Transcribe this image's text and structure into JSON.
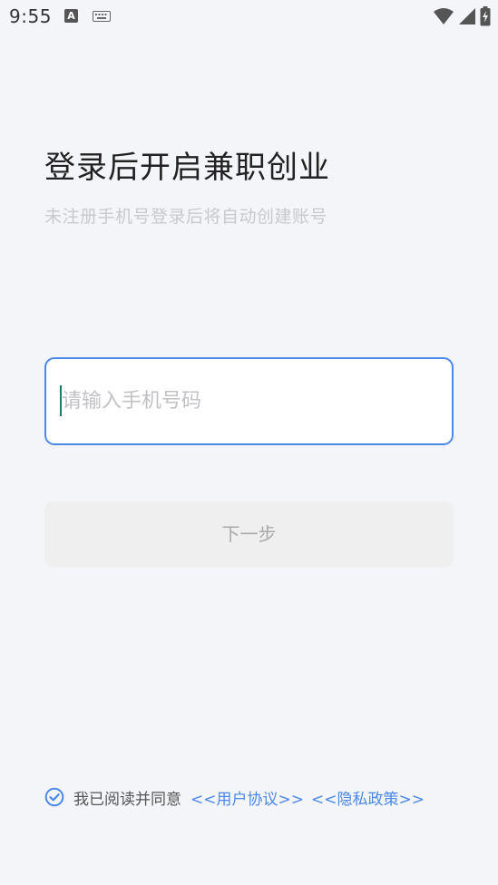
{
  "status_bar": {
    "time": "9:55",
    "notification_letter": "A"
  },
  "header": {
    "title": "登录后开启兼职创业",
    "subtitle": "未注册手机号登录后将自动创建账号"
  },
  "phone": {
    "value": "",
    "placeholder": "请输入手机号码"
  },
  "next_button": {
    "label": "下一步"
  },
  "agreement": {
    "checked": true,
    "text": "我已阅读并同意",
    "user_agreement": "<<用户协议>>",
    "privacy_policy": "<<隐私政策>>"
  },
  "colors": {
    "accent": "#4a88ea",
    "background": "#f4f5f9",
    "button_disabled": "#efefef",
    "caret": "#1e7a6f"
  }
}
